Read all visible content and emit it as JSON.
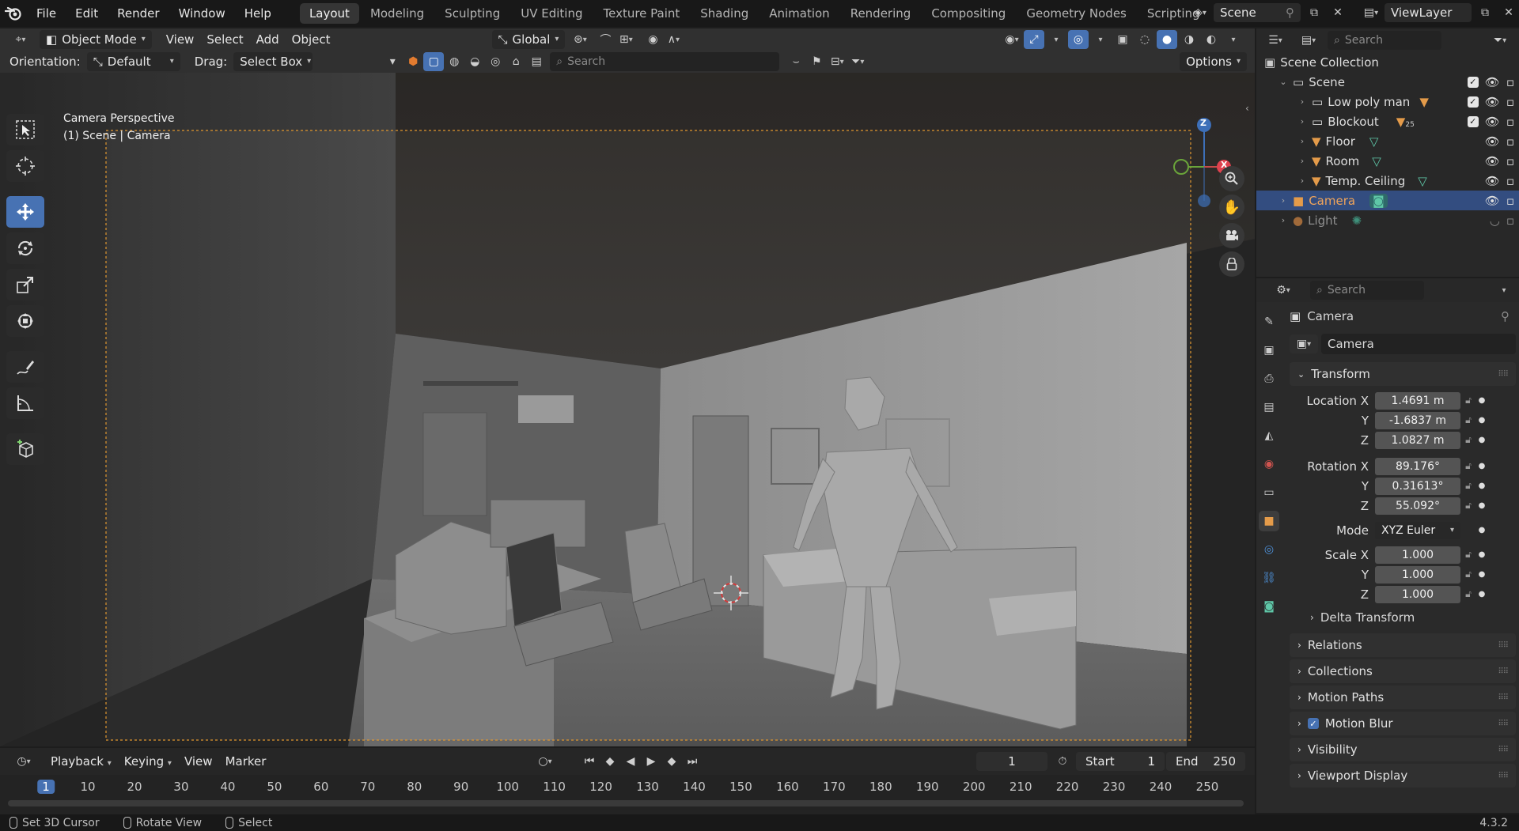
{
  "topbar": {
    "menus": [
      "File",
      "Edit",
      "Render",
      "Window",
      "Help"
    ],
    "workspaces": [
      "Layout",
      "Modeling",
      "Sculpting",
      "UV Editing",
      "Texture Paint",
      "Shading",
      "Animation",
      "Rendering",
      "Compositing",
      "Geometry Nodes",
      "Scripting"
    ],
    "active_workspace": "Layout",
    "add_tab": "+",
    "scene_name": "Scene",
    "view_layer": "ViewLayer"
  },
  "viewport": {
    "header": {
      "mode": "Object Mode",
      "menus": [
        "View",
        "Select",
        "Add",
        "Object"
      ],
      "transform_orientation": "Global",
      "orientation_label": "Orientation:",
      "orientation_value": "Default",
      "drag_label": "Drag:",
      "drag_value": "Select Box",
      "search_placeholder": "Search",
      "options_label": "Options"
    },
    "overlay_text": {
      "line1": "Camera Perspective",
      "line2": "(1) Scene | Camera"
    },
    "gizmo": {
      "z": "Z",
      "x": "X"
    }
  },
  "timeline": {
    "menus": [
      "Playback",
      "Keying",
      "View",
      "Marker"
    ],
    "current_frame": "1",
    "start_label": "Start",
    "start_value": "1",
    "end_label": "End",
    "end_value": "250",
    "ruler": [
      "1",
      "10",
      "20",
      "30",
      "40",
      "50",
      "60",
      "70",
      "80",
      "90",
      "100",
      "110",
      "120",
      "130",
      "140",
      "150",
      "160",
      "170",
      "180",
      "190",
      "200",
      "210",
      "220",
      "230",
      "240",
      "250"
    ]
  },
  "outliner": {
    "search_placeholder": "Search",
    "root": "Scene Collection",
    "items": [
      {
        "label": "Scene",
        "type": "collection"
      },
      {
        "label": "Low poly man",
        "type": "collection"
      },
      {
        "label": "Blockout",
        "type": "collection",
        "badge": "25"
      },
      {
        "label": "Floor",
        "type": "mesh"
      },
      {
        "label": "Room",
        "type": "mesh"
      },
      {
        "label": "Temp. Ceiling",
        "type": "mesh"
      },
      {
        "label": "Camera",
        "type": "camera"
      },
      {
        "label": "Light",
        "type": "light"
      }
    ]
  },
  "properties": {
    "search_placeholder": "Search",
    "context_title": "Camera",
    "object_name": "Camera",
    "transform": {
      "title": "Transform",
      "location_label": "Location X",
      "location": [
        "1.4691 m",
        "-1.6837 m",
        "1.0827 m"
      ],
      "rotation_label": "Rotation X",
      "rotation": [
        "89.176°",
        "0.31613°",
        "55.092°"
      ],
      "mode_label": "Mode",
      "mode_value": "XYZ Euler",
      "scale_label": "Scale X",
      "scale": [
        "1.000",
        "1.000",
        "1.000"
      ],
      "y_label": "Y",
      "z_label": "Z"
    },
    "delta_transform": "Delta Transform",
    "panels": [
      "Relations",
      "Collections",
      "Motion Paths",
      "Motion Blur",
      "Visibility",
      "Viewport Display"
    ]
  },
  "statusbar": {
    "items": [
      "Set 3D Cursor",
      "Rotate View",
      "Select"
    ],
    "version": "4.3.2"
  },
  "colors": {
    "accent": "#4772b3",
    "selected_row": "#334d80",
    "camera_orange": "#e49b4a",
    "mesh_green": "#5fc7a8"
  }
}
